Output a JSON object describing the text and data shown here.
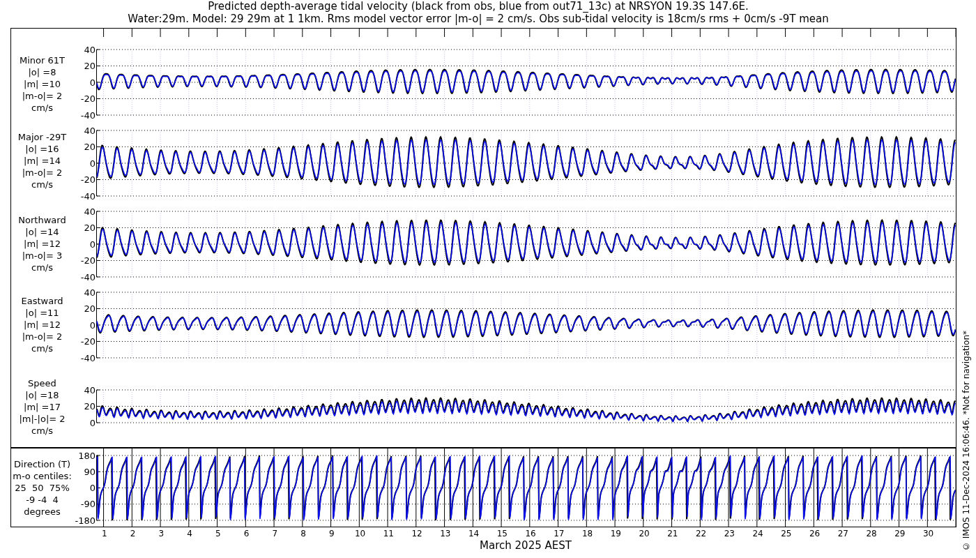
{
  "title_lines": [
    "Predicted depth-average tidal velocity (black from obs, blue from out71_13c) at NRSYON 19.3S 147.6E.",
    "Water:29m. Model: 29 29m at 1 1km. Rms model vector error |m-o| = 2 cm/s. Obs sub-tidal velocity is 18cm/s rms + 0cm/s -9T mean"
  ],
  "panels": [
    {
      "kind": "minor",
      "label_lines": [
        "Minor 61T",
        "|o| =8",
        "|m| =10",
        "|m-o|= 2",
        "cm/s"
      ],
      "yticks": [
        "40",
        "20",
        "0",
        "-20",
        "-40"
      ]
    },
    {
      "kind": "major",
      "label_lines": [
        "Major -29T",
        "|o| =16",
        "|m| =14",
        "|m-o|= 2",
        "cm/s"
      ],
      "yticks": [
        "40",
        "20",
        "0",
        "-20",
        "-40"
      ]
    },
    {
      "kind": "northward",
      "label_lines": [
        "Northward",
        "|o| =14",
        "|m| =12",
        "|m-o|= 3",
        "cm/s"
      ],
      "yticks": [
        "40",
        "20",
        "0",
        "-20",
        "-40"
      ]
    },
    {
      "kind": "eastward",
      "label_lines": [
        "Eastward",
        "|o| =11",
        "|m| =12",
        "|m-o|= 2",
        "cm/s"
      ],
      "yticks": [
        "40",
        "20",
        "0",
        "-20",
        "-40"
      ]
    },
    {
      "kind": "speed",
      "label_lines": [
        "Speed",
        "|o| =18",
        "|m| =17",
        "|m|-|o|= 2",
        "cm/s"
      ],
      "yticks": [
        "40",
        "20",
        "0"
      ]
    },
    {
      "kind": "direction",
      "label_lines": [
        "Direction (T)",
        "m-o centiles:",
        "25  50  75%",
        "-9 -4  4",
        "degrees"
      ],
      "yticks": [
        "180",
        "90",
        "0",
        "-90",
        "-180"
      ]
    }
  ],
  "day_labels": [
    "1",
    "2",
    "3",
    "4",
    "5",
    "6",
    "7",
    "8",
    "9",
    "10",
    "11",
    "12",
    "13",
    "14",
    "15",
    "16",
    "17",
    "18",
    "19",
    "20",
    "21",
    "22",
    "23",
    "24",
    "25",
    "26",
    "27",
    "28",
    "29",
    "30"
  ],
  "xlabel": "March 2025 AEST",
  "side_note": "© IMOS 11-Dec-2024 16:06:46. *Not for navigation*"
}
